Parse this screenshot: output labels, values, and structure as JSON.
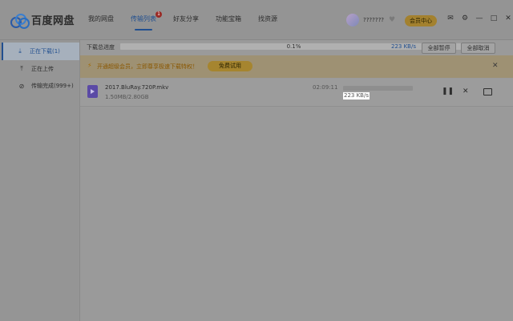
{
  "app": {
    "name": "百度网盘"
  },
  "nav": [
    {
      "label": "我的网盘",
      "active": false
    },
    {
      "label": "传输列表",
      "active": true,
      "badge": "1"
    },
    {
      "label": "好友分享",
      "active": false
    },
    {
      "label": "功能宝箱",
      "active": false
    },
    {
      "label": "找资源",
      "active": false
    }
  ],
  "user": {
    "name": "???????",
    "vip_label": "会员中心"
  },
  "sidebar": {
    "items": [
      {
        "label": "正在下载(1)",
        "icon": "download-icon",
        "active": true
      },
      {
        "label": "正在上传",
        "icon": "upload-icon",
        "active": false
      },
      {
        "label": "传输完成(999+)",
        "icon": "check-circle-icon",
        "active": false
      }
    ]
  },
  "progress": {
    "label": "下载总进度",
    "percent_text": "0.1%",
    "percent": 0.1,
    "speed": "223 KB/s",
    "pause_all": "全部暂停",
    "cancel_all": "全部取消"
  },
  "banner": {
    "text": "开通超级会员，立即尊享极速下载特权！",
    "button": "免费试用"
  },
  "downloads": [
    {
      "name": "2017.BluRay.720P.mkv",
      "size": "1.50MB/2.80GB",
      "time_left": "02:09:11",
      "speed": "223 KB/s",
      "progress": 0.1
    }
  ],
  "colors": {
    "accent": "#214f8f",
    "vip": "#a3812f",
    "badge": "#9a2a25"
  }
}
